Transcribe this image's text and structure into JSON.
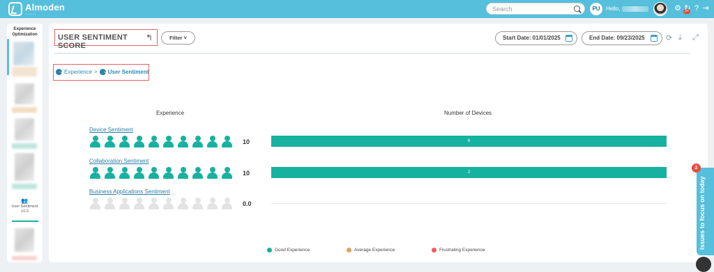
{
  "app": {
    "name": "Almoden",
    "tagline": "... ... ...",
    "search_placeholder": "Search",
    "user_initials": "PU",
    "greeting": "Hello,",
    "notification_count": "3+"
  },
  "sidebar": {
    "title": "Experience Optimization",
    "user_sentiment_label": "User Sentiment",
    "user_sentiment_value": "10.0"
  },
  "page": {
    "title": "USER SENTIMENT SCORE",
    "filter_label": "Filter",
    "start_date": "Start Date: 01/01/2025",
    "end_date": "End Date: 09/23/2025"
  },
  "breadcrumb": {
    "parent": "Experience",
    "separator": ">",
    "current": "User Sentiment"
  },
  "table": {
    "col_experience": "Experience",
    "col_devices": "Number of Devices",
    "rows": [
      {
        "label": "Device Sentiment",
        "score": "10",
        "filled": 10,
        "devices": "6"
      },
      {
        "label": "Collaboration Sentiment",
        "score": "10",
        "filled": 10,
        "devices": "2"
      },
      {
        "label": "Business Applications Sentiment",
        "score": "0.0",
        "filled": 0,
        "devices": ""
      }
    ]
  },
  "legend": [
    {
      "label": "Good Experience",
      "color": "#17b1a0"
    },
    {
      "label": "Average Experience",
      "color": "#e0a458"
    },
    {
      "label": "Frustrating Experience",
      "color": "#ef5b5b"
    }
  ],
  "issues": {
    "label": "Issues to focus on today",
    "count": "2"
  },
  "colors": {
    "brand": "#56bfdc",
    "good": "#17b1a0",
    "alert": "#e06464"
  }
}
